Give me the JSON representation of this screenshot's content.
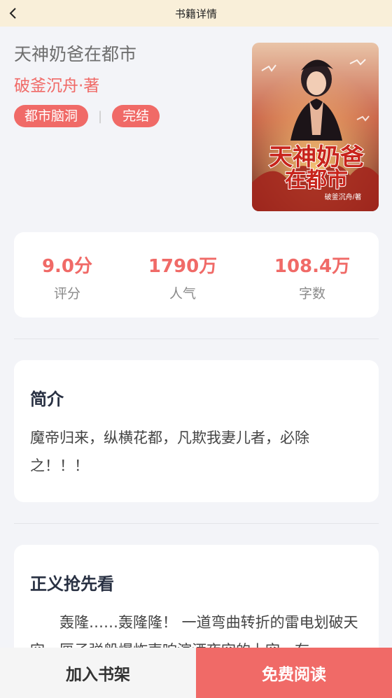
{
  "header": {
    "title": "书籍详情",
    "back_icon": "chevron-left-icon"
  },
  "book": {
    "title": "天神奶爸在都市",
    "author": "破釜沉舟·著",
    "tags": [
      "都市脑洞",
      "完结"
    ],
    "cover": {
      "title_line1": "天神奶爸",
      "title_line2": "在都市",
      "author_mark": "破釜沉舟/著"
    }
  },
  "stats": [
    {
      "value": "9.0分",
      "label": "评分"
    },
    {
      "value": "1790万",
      "label": "人气"
    },
    {
      "value": "108.4万",
      "label": "字数"
    }
  ],
  "intro": {
    "heading": "简介",
    "text": "魔帝归来，纵横花都，凡欺我妻儿者，必除之！！！"
  },
  "preview": {
    "heading": "正义抢先看",
    "text": "轰隆……轰隆隆！ 一道弯曲转折的雷电划破天空，匣子弹般爆炸声响渲洒夜空的上空，有"
  },
  "actions": {
    "add_shelf": "加入书架",
    "read_free": "免费阅读"
  },
  "colors": {
    "accent": "#f06a67",
    "header_bg": "#f9efd9",
    "page_bg": "#f3f4f8"
  }
}
